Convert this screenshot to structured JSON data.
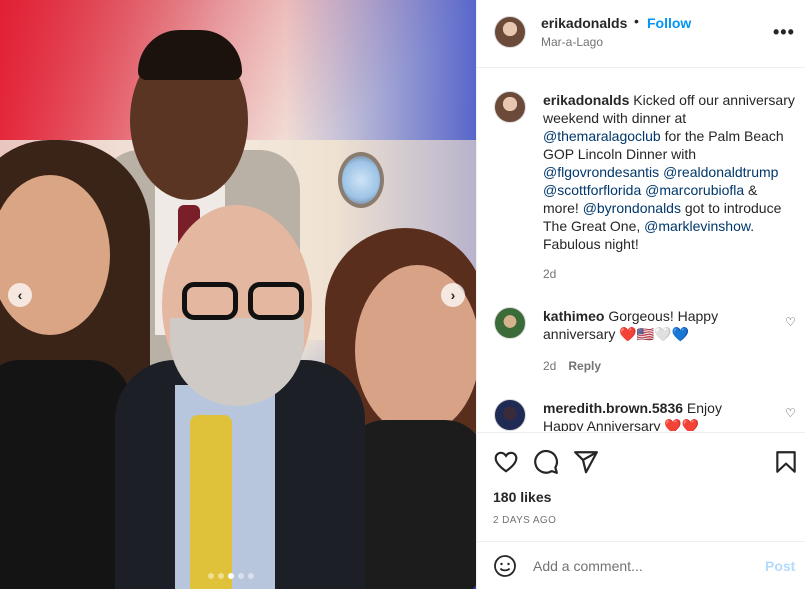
{
  "post": {
    "username": "erikadonalds",
    "separator": "•",
    "follow_label": "Follow",
    "location": "Mar-a-Lago",
    "more_label": "•••",
    "caption": {
      "username": "erikadonalds",
      "t1": " Kicked off our anniversary weekend with dinner at ",
      "m1": "@themaralagoclub",
      "t2": " for the Palm Beach GOP Lincoln Dinner with ",
      "m2": "@flgovrondesantis",
      "m3": "@realdonaldtrump",
      "m4": "@scottforflorida",
      "m5": "@marcorubiofla",
      "t3": " & more! ",
      "m6": "@byrondonalds",
      "t4": " got to introduce The Great One, ",
      "m7": "@marklevinshow",
      "t5": ". Fabulous night!",
      "time": "2d"
    },
    "comments": [
      {
        "username": "kathimeo",
        "text": " Gorgeous! Happy anniversary ❤️🇺🇸🤍💙",
        "time": "2d",
        "reply_label": "Reply"
      },
      {
        "username": "meredith.brown.5836",
        "text": " Enjoy Happy Anniversary ❤️❤️"
      }
    ],
    "likes": "180 likes",
    "date": "2 DAYS AGO",
    "add_comment_placeholder": "Add a comment...",
    "post_label": "Post"
  },
  "carousel": {
    "prev_label": "‹",
    "next_label": "›",
    "slide_count": 5,
    "active_slide": 3
  },
  "icons": {
    "like": "heart-icon",
    "comment": "speech-bubble-icon",
    "share": "paper-plane-icon",
    "save": "bookmark-icon",
    "emoji": "smiley-icon"
  },
  "colors": {
    "link_blue": "#0095f6",
    "mention": "#00376b",
    "muted": "#737373",
    "post_disabled": "#b3dbff"
  }
}
